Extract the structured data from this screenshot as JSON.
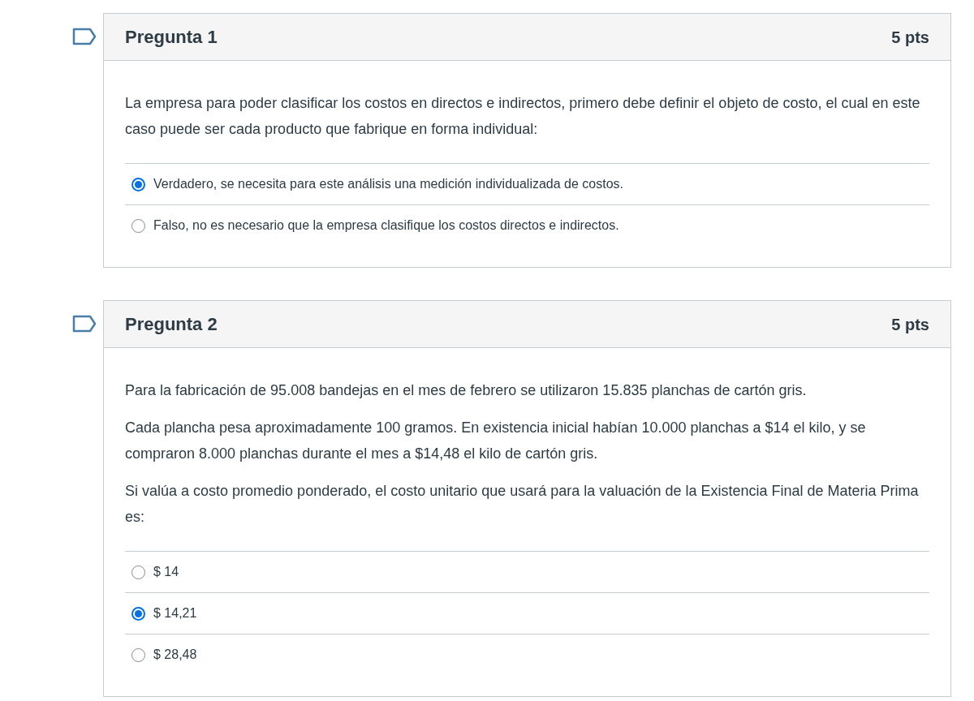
{
  "questions": [
    {
      "title": "Pregunta 1",
      "points": "5 pts",
      "paragraphs": [
        "La empresa para poder clasificar los costos en directos e indirectos, primero debe definir el objeto de costo, el cual en este caso puede ser cada producto que fabrique en forma individual:"
      ],
      "answers": [
        {
          "text": "Verdadero, se necesita para este análisis una medición individualizada de costos.",
          "selected": true
        },
        {
          "text": "Falso, no es necesario que la empresa clasifique los costos directos e indirectos.",
          "selected": false
        }
      ]
    },
    {
      "title": "Pregunta 2",
      "points": "5 pts",
      "paragraphs": [
        "Para la fabricación de 95.008 bandejas en el mes de febrero se utilizaron 15.835 planchas de cartón gris.",
        "Cada plancha pesa aproximadamente 100 gramos. En existencia inicial habían 10.000 planchas a $14 el kilo, y se compraron 8.000 planchas durante el mes a $14,48 el kilo de cartón gris.",
        "Si valúa a costo promedio ponderado, el costo unitario que usará para la valuación de la Existencia Final de Materia Prima es:"
      ],
      "answers": [
        {
          "text": "$ 14",
          "selected": false
        },
        {
          "text": "$ 14,21",
          "selected": true
        },
        {
          "text": "$ 28,48",
          "selected": false
        }
      ]
    }
  ]
}
